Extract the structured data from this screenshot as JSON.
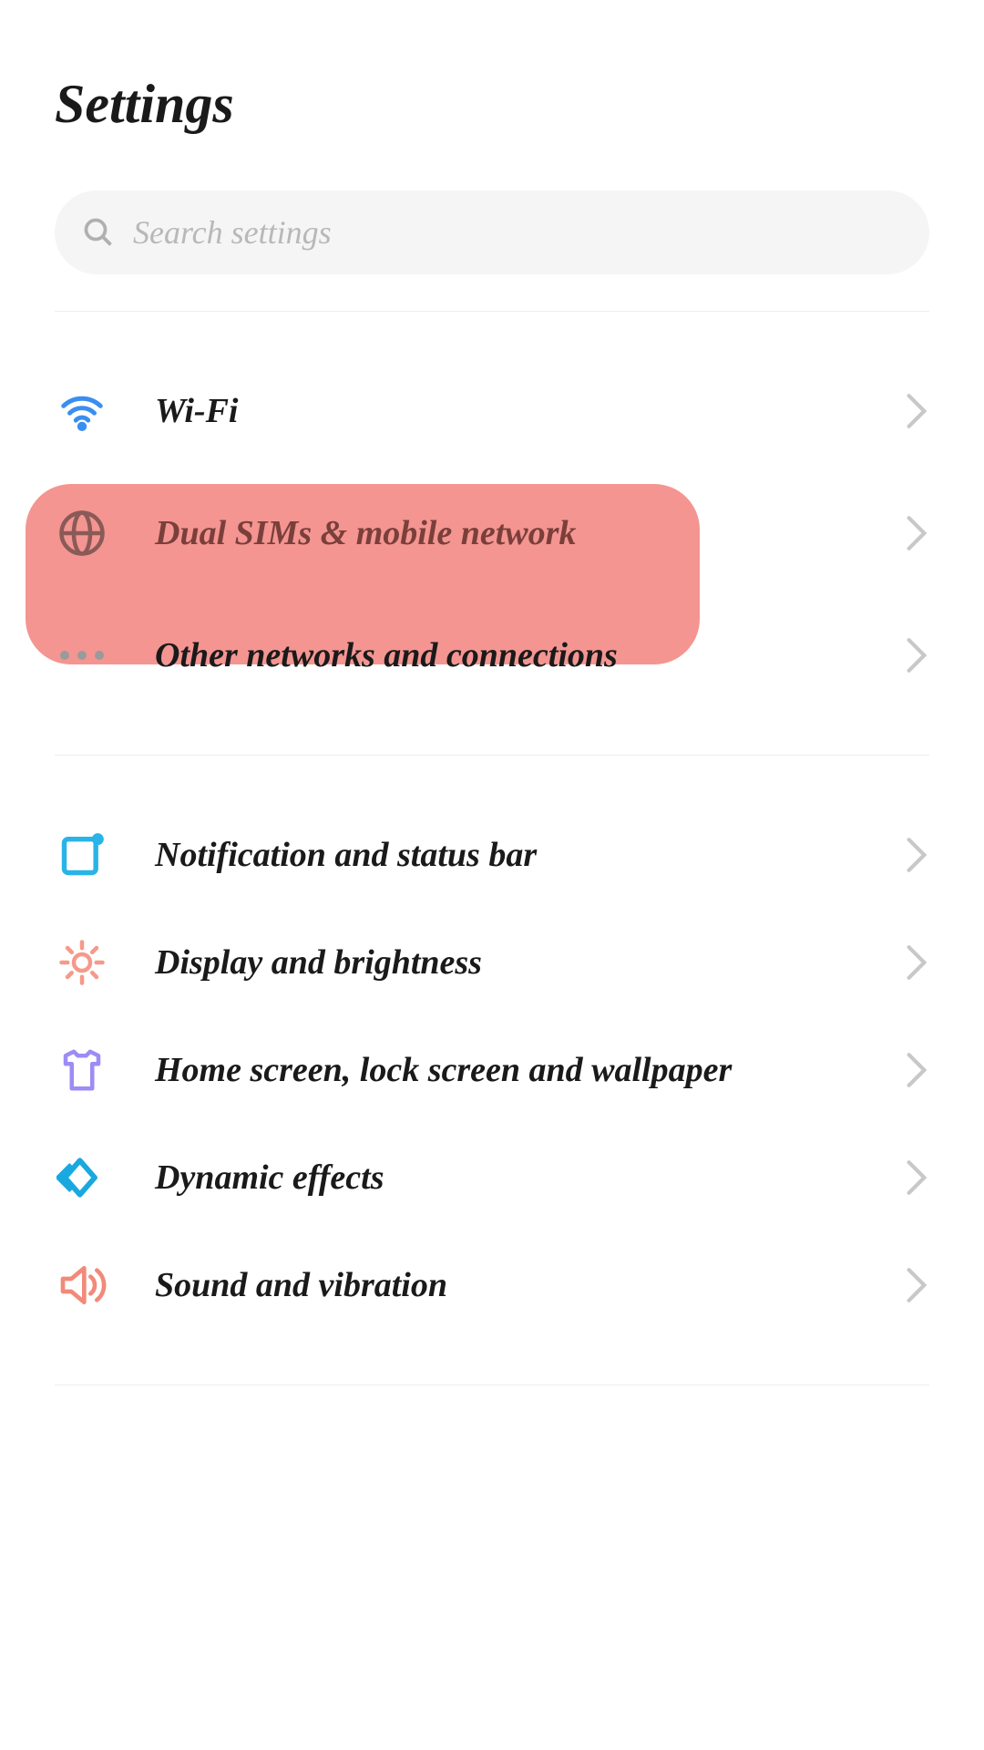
{
  "header": {
    "title": "Settings"
  },
  "search": {
    "placeholder": "Search settings"
  },
  "sections": [
    {
      "items": [
        {
          "label": "Wi-Fi"
        },
        {
          "label": "Dual SIMs & mobile network"
        },
        {
          "label": "Other networks and connections"
        }
      ]
    },
    {
      "items": [
        {
          "label": "Notification and status bar"
        },
        {
          "label": "Display and brightness"
        },
        {
          "label": "Home screen, lock screen and wallpaper"
        },
        {
          "label": "Dynamic effects"
        },
        {
          "label": "Sound and vibration"
        }
      ]
    }
  ],
  "icon_colors": {
    "wifi": "#3a8ef0",
    "globe": "#8a5a57",
    "dots": "#9a9a9a",
    "notification": "#29b4e8",
    "brightness": "#f59a8a",
    "tshirt": "#9c8cf5",
    "dynamic": "#1aa8e0",
    "sound": "#f28a7a",
    "chevron": "#c8c8c8",
    "search": "#b0b0b0"
  }
}
